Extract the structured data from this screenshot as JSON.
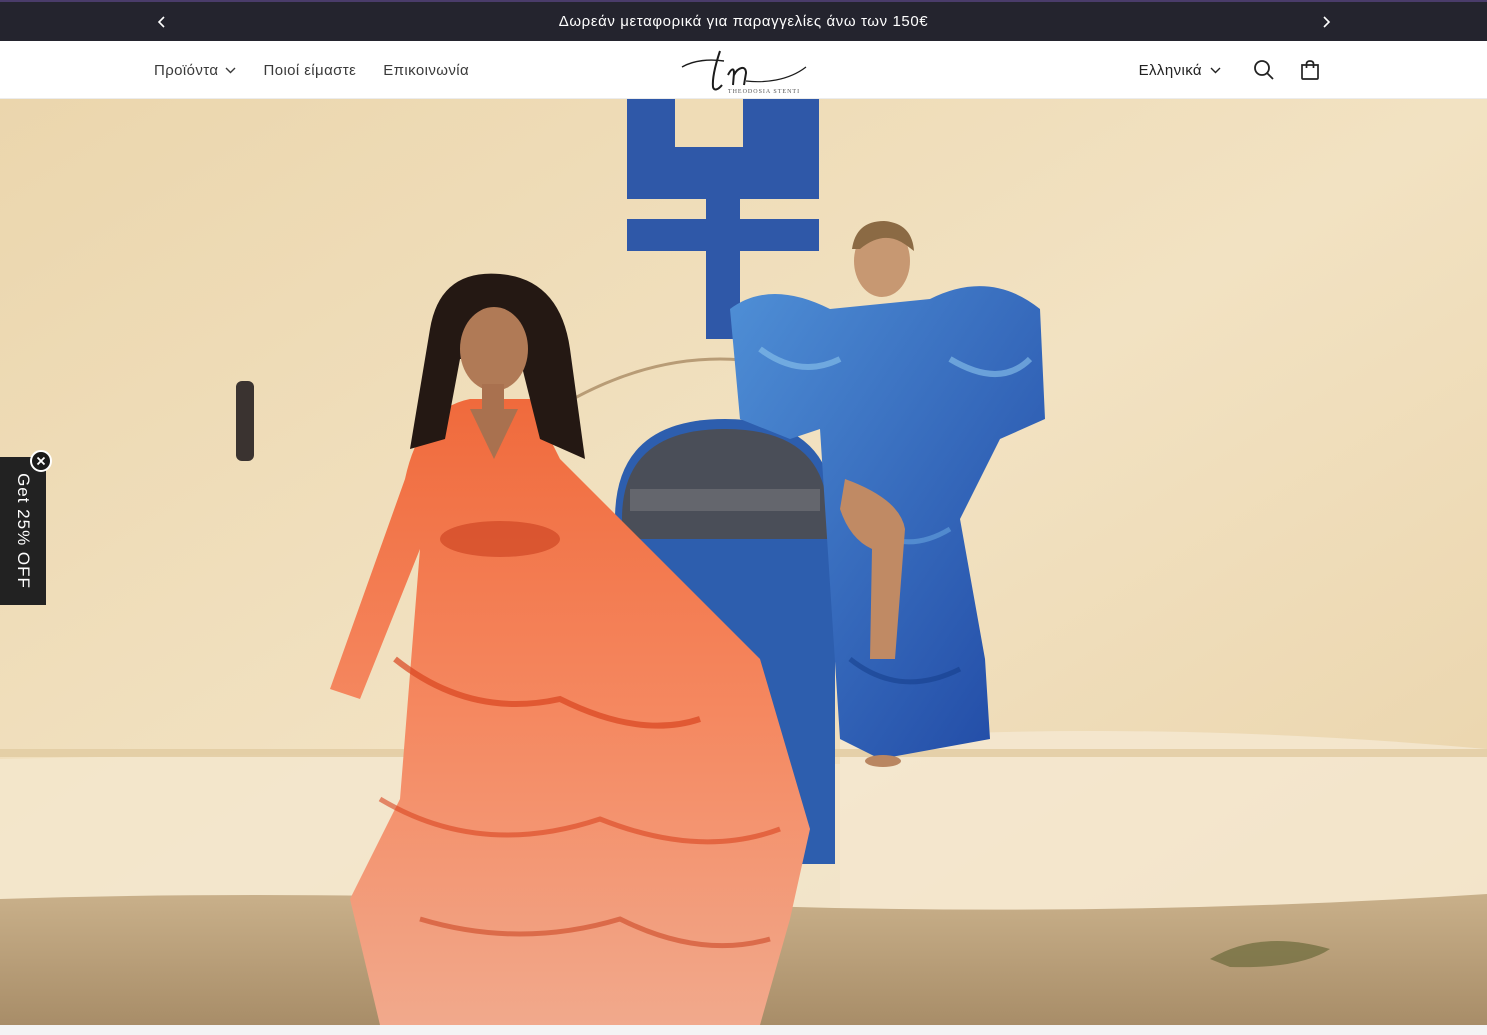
{
  "announcement": {
    "text": "Δωρεάν μεταφορικά για παραγγελίες άνω των 150€",
    "prev_icon": "chevron-left-icon",
    "next_icon": "chevron-right-icon"
  },
  "header": {
    "nav": [
      {
        "label": "Προϊόντα",
        "has_dropdown": true
      },
      {
        "label": "Ποιοί είμαστε",
        "has_dropdown": false
      },
      {
        "label": "Επικοινωνία",
        "has_dropdown": false
      }
    ],
    "logo": {
      "monogram": "tn",
      "wordmark": "THEODOSIA STENTI"
    },
    "language": "Ελληνικά",
    "search_icon": "search-icon",
    "cart_icon": "cart-icon"
  },
  "promo": {
    "label": "Get 25% OFF",
    "close_icon": "close-icon"
  },
  "colors": {
    "announcement_bg": "#24242e",
    "promo_bg": "#222222",
    "wall": "#efdcb6",
    "window_blue": "#2f58a8"
  }
}
